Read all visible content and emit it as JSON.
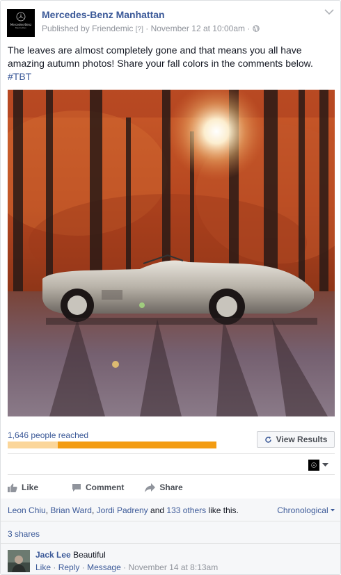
{
  "post": {
    "page_name": "Mercedes-Benz Manhattan",
    "published_by_prefix": "Published by",
    "publisher": "Friendemic",
    "help_marker": "[?]",
    "separator": "·",
    "date": "November 12 at 10:00am",
    "audience_icon": "globe-icon",
    "text": "The leaves are almost completely gone and that means you all have amazing autumn photos! Share your fall colors in the comments below.",
    "hashtag": "#TBT",
    "avatar_text_1": "Mercedes-Benz",
    "avatar_text_2": "Manhattan"
  },
  "insights": {
    "reach_label": "1,646 people reached",
    "view_results_label": "View Results",
    "organic_fraction": 0.24,
    "colors": {
      "organic": "#fbd69a",
      "paid": "#f39c12"
    }
  },
  "actions": {
    "like": "Like",
    "comment": "Comment",
    "share": "Share"
  },
  "feedback": {
    "likers": [
      "Leon Chiu",
      "Brian Ward",
      "Jordi Padreny"
    ],
    "and_text": "and",
    "others": "133 others",
    "like_suffix": "like this.",
    "sort_label": "Chronological",
    "shares": "3 shares"
  },
  "comment": {
    "author": "Jack Lee",
    "text": "Beautiful",
    "like": "Like",
    "reply": "Reply",
    "message": "Message",
    "separator": "·",
    "date": "November 14 at 8:13am"
  },
  "colors": {
    "link": "#3b5998",
    "feedback_bg": "#f6f7f9"
  }
}
